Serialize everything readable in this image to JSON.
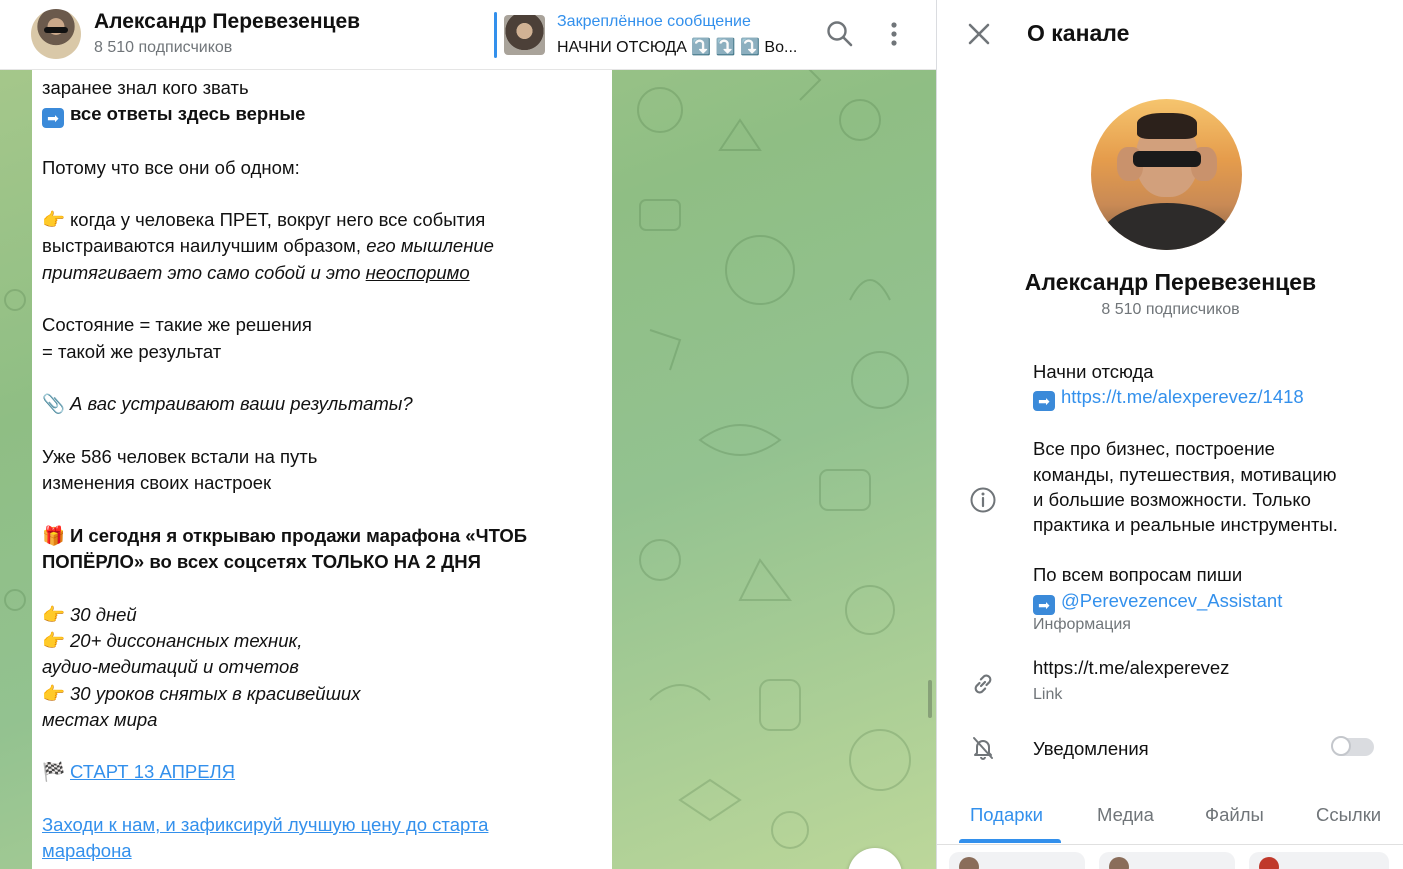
{
  "header": {
    "channel_name": "Александр Перевезенцев",
    "subscribers": "8 510 подписчиков",
    "pinned_title": "Закреплённое сообщение",
    "pinned_text": "НАЧНИ ОТСЮДА ⤵️ ⤵️ ⤵️ Во..."
  },
  "message": {
    "line1": "заранее знал кого звать",
    "line2": "все ответы здесь верные",
    "line3": "Потому что все они об одном:",
    "line4a": "когда у человека ПРЕТ, вокруг него все события",
    "line4b": "выстраиваются наилучшим образом, ",
    "line4b_em": "его мышление",
    "line4c_em": "притягивает это само собой и это ",
    "line4c_u": "неоспоримо",
    "line5": "Состояние = такие же решения",
    "line6": "= такой же результат",
    "line7": "А вас устраивают ваши результаты?",
    "line8": "Уже 586 человек встали на путь",
    "line9": "изменения своих настроек",
    "line10": "И сегодня я открываю продажи марафона «ЧТОБ",
    "line11": "ПОПЁРЛО» во всех соцсетях ТОЛЬКО НА 2 ДНЯ",
    "bullet1": "30 дней",
    "bullet2": "20+ диссонансных техник,",
    "bullet2b": "аудио-медитаций и отчетов",
    "bullet3": "30 уроков снятых в красивейших",
    "bullet3b": "местах мира",
    "start_link": "СТАРТ 13 АПРЕЛЯ",
    "cta_link_1": "Заходи к нам, и зафиксируй лучшую цену до старта",
    "cta_link_2": "марафона"
  },
  "panel": {
    "title": "О канале",
    "name": "Александр Перевезенцев",
    "subscribers": "8 510 подписчиков",
    "about_start": "Начни отсюда",
    "about_link": "https://t.me/alexperevez/1418",
    "about_desc_1": "Все про бизнес, построение",
    "about_desc_2": "команды, путешествия, мотивацию",
    "about_desc_3": "и большие возможности. Только",
    "about_desc_4": "практика и реальные инструменты.",
    "about_contact": "По всем вопросам пиши",
    "about_handle": "@Perevezencev_Assistant",
    "about_caption": "Информация",
    "link": "https://t.me/alexperevez",
    "link_caption": "Link",
    "notifications": "Уведомления",
    "notifications_on": false,
    "tabs": [
      "Подарки",
      "Медиа",
      "Файлы",
      "Ссылки"
    ],
    "active_tab": "Подарки"
  },
  "colors": {
    "accent": "#3390ec",
    "secondary_text": "#707579",
    "chat_bg": "#9cc58a"
  },
  "icons": [
    "search-icon",
    "more-icon",
    "close-icon",
    "info-icon",
    "link-icon",
    "bell-off-icon",
    "arrow-right-emoji",
    "pointing-hand-emoji",
    "paperclip-emoji",
    "gift-emoji",
    "checkered-flag-emoji"
  ]
}
